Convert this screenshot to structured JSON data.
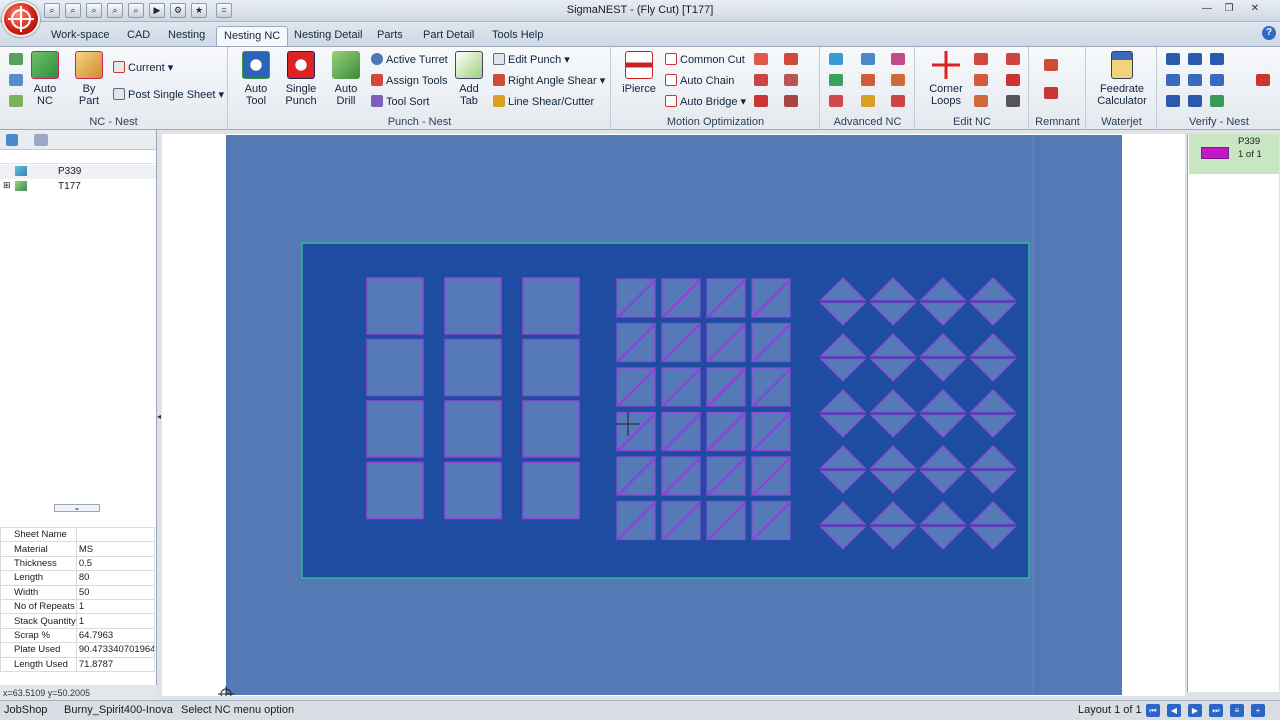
{
  "window": {
    "title": "SigmaNEST  -  (Fly Cut) [T177]",
    "buttons": [
      "—",
      "❐",
      "✕"
    ]
  },
  "quick_access": [
    "⌕",
    "⌕",
    "⌕",
    "⌕",
    "⌕",
    "▶",
    "⚙",
    "★",
    "="
  ],
  "tabs": [
    "Work-space",
    "CAD",
    "Nesting",
    "Nesting NC",
    "Nesting Detail",
    "Parts",
    "Part Detail",
    "Tools Help"
  ],
  "active_tab": "Nesting NC",
  "help_icon": "?",
  "ribbon": {
    "nc_nest": {
      "label": "NC - Nest",
      "auto_nc": "Auto NC",
      "by_part": "By Part",
      "current": "Current",
      "post_single_sheet": "Post Single Sheet"
    },
    "punch_nest": {
      "label": "Punch - Nest",
      "auto_tool": "Auto Tool",
      "single_punch": "Single Punch",
      "auto_drill": "Auto Drill",
      "active_turret": "Active Turret",
      "assign_tools": "Assign Tools",
      "tool_sort": "Tool Sort",
      "add_tab": "Add Tab",
      "edit_punch": "Edit Punch",
      "right_angle_shear": "Right Angle Shear",
      "line_shear_cutter": "Line Shear/Cutter"
    },
    "motion_optimization": {
      "label": "Motion Optimization",
      "ipierce": "iPierce",
      "common_cut": "Common Cut",
      "auto_chain": "Auto Chain",
      "auto_bridge": "Auto Bridge"
    },
    "advanced_nc": {
      "label": "Advanced NC"
    },
    "edit_nc": {
      "label": "Edit NC",
      "corner_loops": "Corner Loops"
    },
    "remnant": {
      "label": "Remnant"
    },
    "waterjet": {
      "label": "Waterjet",
      "feedrate_calculator": "Feedrate Calculator"
    },
    "verify_nest": {
      "label": "Verify - Nest"
    }
  },
  "tree": [
    {
      "label": "P339",
      "icon": "part-icon",
      "expander": ""
    },
    {
      "label": "T177",
      "icon": "task-icon",
      "expander": "⊞"
    }
  ],
  "splitter_glyph": "⌄",
  "splitter_arrow": "◂",
  "properties": [
    {
      "name": "Sheet Name",
      "value": ""
    },
    {
      "name": "Material",
      "value": "MS"
    },
    {
      "name": "Thickness",
      "value": "0.5"
    },
    {
      "name": "Length",
      "value": "80"
    },
    {
      "name": "Width",
      "value": "50"
    },
    {
      "name": "No of Repeats",
      "value": "1"
    },
    {
      "name": "Stack Quantity",
      "value": "1"
    },
    {
      "name": "Scrap %",
      "value": "64.7963"
    },
    {
      "name": "Plate Used",
      "value": "90.473340701964"
    },
    {
      "name": "Length Used",
      "value": "71.8787"
    }
  ],
  "coordinates": "x=63.5109 y=50.2005",
  "layout_thumb": {
    "label": "P339",
    "page": "1 of 1"
  },
  "colors": {
    "sheet": "#5479b5",
    "plate": "#1d4ca0",
    "part": "#5679b8",
    "part_outline": "#9048d8",
    "plate_outline": "#2fb89a",
    "selection": "#c8e6c2"
  },
  "status": {
    "mode": "JobShop",
    "machine": "Burny_Spirit400-Inova",
    "message": "Select NC menu option",
    "layout": "Layout 1 of 1"
  }
}
